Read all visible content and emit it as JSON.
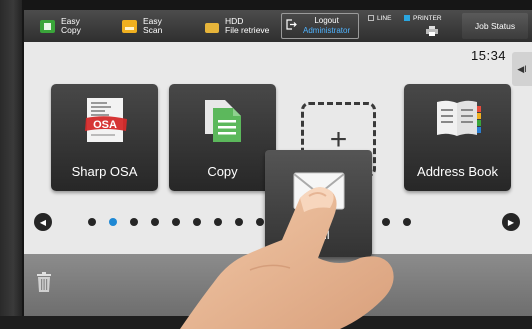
{
  "topbar": {
    "easy_copy": "Easy\nCopy",
    "easy_scan": "Easy\nScan",
    "hdd": "HDD\nFile retrieve",
    "logout_label": "Logout",
    "logout_user": "Administrator",
    "line_label": "LINE",
    "printer_label": "PRINTER",
    "job_status": "Job Status"
  },
  "clock": {
    "time": "15:34"
  },
  "side_tab": {
    "icon": "◀I"
  },
  "tiles": [
    {
      "label": "Sharp OSA",
      "icon": "sharp-osa-icon"
    },
    {
      "label": "Copy",
      "icon": "copy-icon"
    },
    {
      "label": "Address Book",
      "icon": "address-book-icon"
    }
  ],
  "mail_tile": {
    "label": "Mail",
    "icon": "envelope-icon"
  },
  "add_slot": {
    "symbol": "+"
  },
  "pager": {
    "dots": 16,
    "active_index": 1,
    "prev": "◀",
    "next": "▶"
  },
  "colors": {
    "accent": "#1e88d4",
    "copy_green": "#3aa53a",
    "scan_yellow": "#f0b020",
    "osa_red": "#d42a2a"
  }
}
